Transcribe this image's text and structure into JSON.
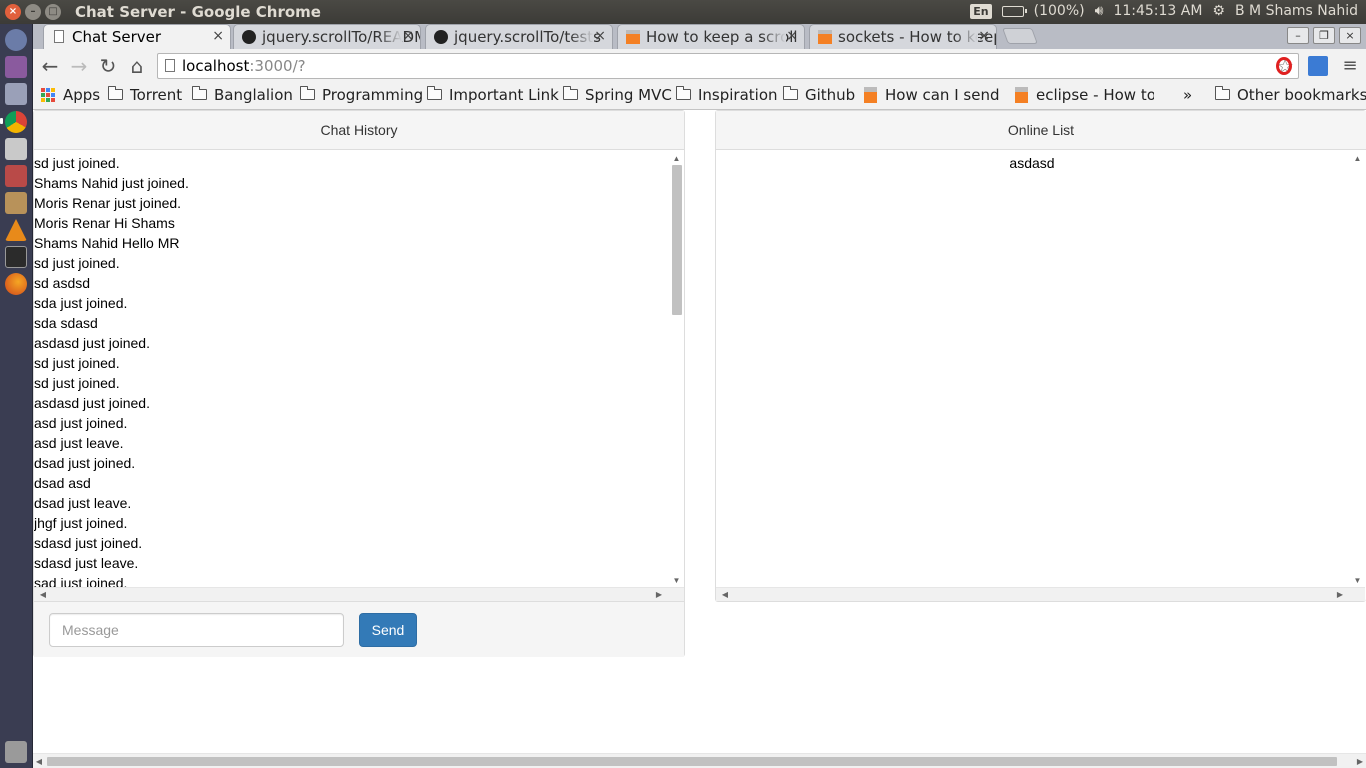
{
  "os_panel": {
    "window_title": "Chat Server - Google Chrome",
    "keyboard_layout": "En",
    "battery": "(100%)",
    "clock": "11:45:13 AM",
    "user_name": "B M Shams Nahid"
  },
  "launcher": {
    "items": [
      "dash-icon",
      "files-icon",
      "software-center-icon",
      "chrome-icon",
      "calendar-icon",
      "desktop-app-icon",
      "archive-icon",
      "vlc-icon",
      "terminal-icon",
      "firefox-icon",
      "trash-icon"
    ]
  },
  "tabs": [
    {
      "label": "Chat Server",
      "icon": "page-icon"
    },
    {
      "label": "jquery.scrollTo/README",
      "icon": "github-icon"
    },
    {
      "label": "jquery.scrollTo/tests",
      "icon": "github-icon"
    },
    {
      "label": "How to keep a scroll",
      "icon": "stackoverflow-icon"
    },
    {
      "label": "sockets - How to keep",
      "icon": "stackoverflow-icon"
    }
  ],
  "address_bar": {
    "host": "localhost",
    "rest": ":3000/?"
  },
  "bookmarks": [
    {
      "label": "Apps",
      "kind": "apps"
    },
    {
      "label": "Torrent",
      "kind": "folder"
    },
    {
      "label": "Banglalion",
      "kind": "folder"
    },
    {
      "label": "Programming",
      "kind": "folder"
    },
    {
      "label": "Important Link",
      "kind": "folder"
    },
    {
      "label": "Spring MVC",
      "kind": "folder"
    },
    {
      "label": "Inspiration",
      "kind": "folder"
    },
    {
      "label": "Github",
      "kind": "folder"
    },
    {
      "label": "How can I send an",
      "kind": "link"
    },
    {
      "label": "eclipse - How to a",
      "kind": "link"
    }
  ],
  "bookmarks_overflow": "»",
  "other_bookmarks": "Other bookmarks",
  "chat_history": {
    "title": "Chat History",
    "messages": [
      "sd just joined.",
      "Shams Nahid just joined.",
      "Moris Renar just joined.",
      "Moris Renar Hi Shams",
      "Shams Nahid Hello MR",
      "sd just joined.",
      "sd asdsd",
      "sda just joined.",
      "sda sdasd",
      "asdasd just joined.",
      "sd just joined.",
      "sd just joined.",
      "asdasd just joined.",
      "asd just joined.",
      "asd just leave.",
      "dsad just joined.",
      "dsad asd",
      "dsad just leave.",
      "jhgf just joined.",
      "sdasd just joined.",
      "sdasd just leave.",
      "sad just joined."
    ],
    "message_placeholder": "Message",
    "send_label": "Send"
  },
  "online_list": {
    "title": "Online List",
    "users": [
      "asdasd"
    ]
  },
  "colors": {
    "send_button": "#337ab7",
    "panel_heading": "#f5f5f5",
    "os_panel": "#3c3b37",
    "launcher": "#3a3d52"
  }
}
